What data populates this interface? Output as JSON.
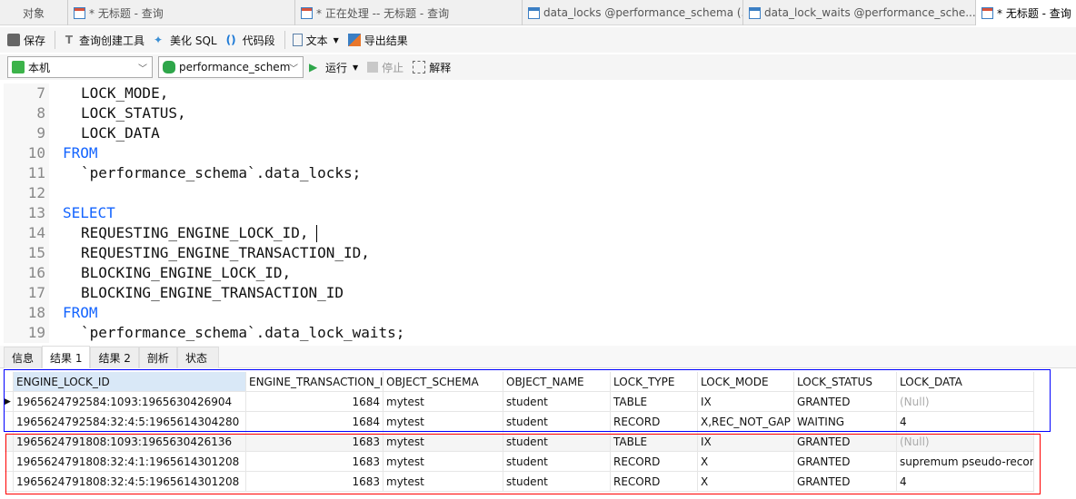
{
  "tabs": [
    {
      "label": "对象",
      "icon": "none"
    },
    {
      "label": "* 无标题 - 查询",
      "icon": "query-icon"
    },
    {
      "label": "* 正在处理 -- 无标题 - 查询",
      "icon": "query-icon"
    },
    {
      "label": "data_locks @performance_schema (...",
      "icon": "table-icon"
    },
    {
      "label": "data_lock_waits @performance_sche...",
      "icon": "table-icon"
    },
    {
      "label": "* 无标题 - 查询",
      "icon": "query-icon",
      "active": true
    }
  ],
  "toolbar": {
    "save": "保存",
    "query_builder": "查询创建工具",
    "beautify": "美化 SQL",
    "snippet": "代码段",
    "text": "文本",
    "export": "导出结果"
  },
  "toolbar2": {
    "connection": "本机",
    "database": "performance_schem",
    "run": "运行",
    "stop": "停止",
    "explain": "解释"
  },
  "editor": {
    "lines": [
      {
        "n": "7",
        "indent": true,
        "text": "LOCK_MODE,"
      },
      {
        "n": "8",
        "indent": true,
        "text": "LOCK_STATUS,"
      },
      {
        "n": "9",
        "indent": true,
        "text": "LOCK_DATA"
      },
      {
        "n": "10",
        "kw": true,
        "text": "FROM"
      },
      {
        "n": "11",
        "indent": true,
        "text": "`performance_schema`.data_locks;"
      },
      {
        "n": "12",
        "text": ""
      },
      {
        "n": "13",
        "kw": true,
        "text": "SELECT"
      },
      {
        "n": "14",
        "indent": true,
        "text": "REQUESTING_ENGINE_LOCK_ID,"
      },
      {
        "n": "15",
        "indent": true,
        "text": "REQUESTING_ENGINE_TRANSACTION_ID,"
      },
      {
        "n": "16",
        "indent": true,
        "text": "BLOCKING_ENGINE_LOCK_ID,"
      },
      {
        "n": "17",
        "indent": true,
        "text": "BLOCKING_ENGINE_TRANSACTION_ID"
      },
      {
        "n": "18",
        "kw": true,
        "text": "FROM"
      },
      {
        "n": "19",
        "indent": true,
        "text": "`performance_schema`.data_lock_waits;"
      }
    ]
  },
  "result_tabs": [
    "信息",
    "结果 1",
    "结果 2",
    "剖析",
    "状态"
  ],
  "grid": {
    "columns": [
      "ENGINE_LOCK_ID",
      "ENGINE_TRANSACTION_ID",
      "OBJECT_SCHEMA",
      "OBJECT_NAME",
      "LOCK_TYPE",
      "LOCK_MODE",
      "LOCK_STATUS",
      "LOCK_DATA"
    ],
    "rows": [
      [
        "1965624792584:1093:1965630426904",
        "1684",
        "mytest",
        "student",
        "TABLE",
        "IX",
        "GRANTED",
        "(Null)"
      ],
      [
        "1965624792584:32:4:5:1965614304280",
        "1684",
        "mytest",
        "student",
        "RECORD",
        "X,REC_NOT_GAP",
        "WAITING",
        "4"
      ],
      [
        "1965624791808:1093:1965630426136",
        "1683",
        "mytest",
        "student",
        "TABLE",
        "IX",
        "GRANTED",
        "(Null)"
      ],
      [
        "1965624791808:32:4:1:1965614301208",
        "1683",
        "mytest",
        "student",
        "RECORD",
        "X",
        "GRANTED",
        "supremum pseudo-record"
      ],
      [
        "1965624791808:32:4:5:1965614301208",
        "1683",
        "mytest",
        "student",
        "RECORD",
        "X",
        "GRANTED",
        "4"
      ]
    ]
  },
  "colors": {
    "keyword": "#1565ff",
    "highlight_box_1": "#0000ff",
    "highlight_box_2": "#ff0000"
  }
}
